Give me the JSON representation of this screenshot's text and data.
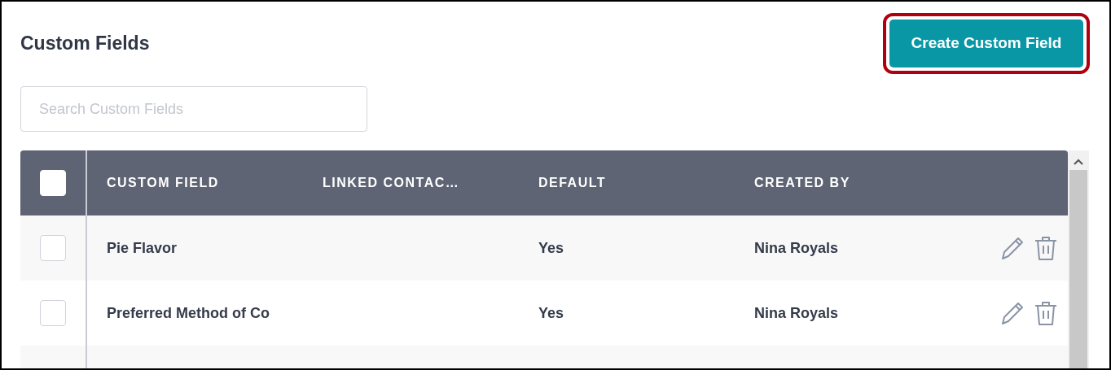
{
  "title": "Custom Fields",
  "create_button": {
    "label": "Create Custom Field",
    "highlighted": true
  },
  "search": {
    "placeholder": "Search Custom Fields"
  },
  "table": {
    "select_all": {
      "checked": false
    },
    "columns": [
      "CUSTOM FIELD",
      "LINKED CONTAC…",
      "DEFAULT",
      "CREATED BY"
    ],
    "rows": [
      {
        "checked": false,
        "cells": [
          "Pie Flavor",
          "",
          "Yes",
          "Nina Royals"
        ]
      },
      {
        "checked": false,
        "cells": [
          "Preferred Method of Co",
          "",
          "Yes",
          "Nina Royals"
        ]
      }
    ]
  }
}
